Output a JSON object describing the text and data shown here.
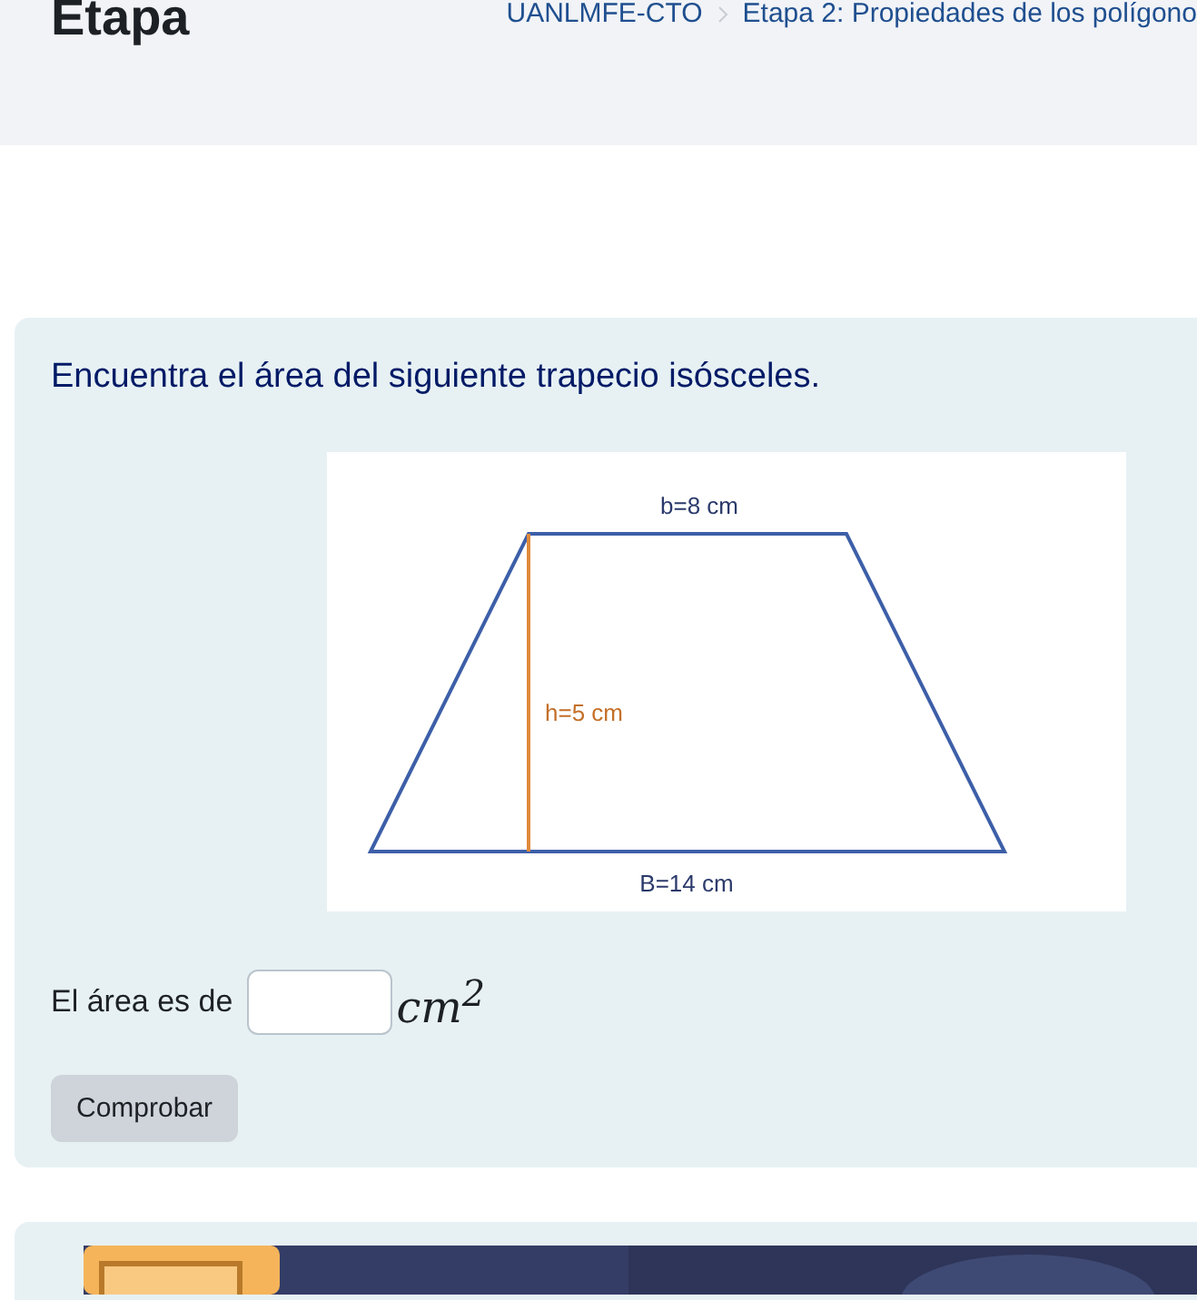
{
  "header": {
    "title": "Etapa",
    "breadcrumbs": [
      {
        "label": "UANLMFE-CTO"
      },
      {
        "label": "Etapa 2: Propiedades de los polígono"
      }
    ]
  },
  "question": {
    "prompt": "Encuentra el área del siguiente trapecio isósceles.",
    "figure": {
      "top_label": "b=8 cm",
      "height_label": "h=5 cm",
      "bottom_label": "B=14 cm"
    },
    "answer_label": "El área es de",
    "answer": {
      "unit": "cm",
      "exponent": "2"
    },
    "check_button": "Comprobar"
  }
}
